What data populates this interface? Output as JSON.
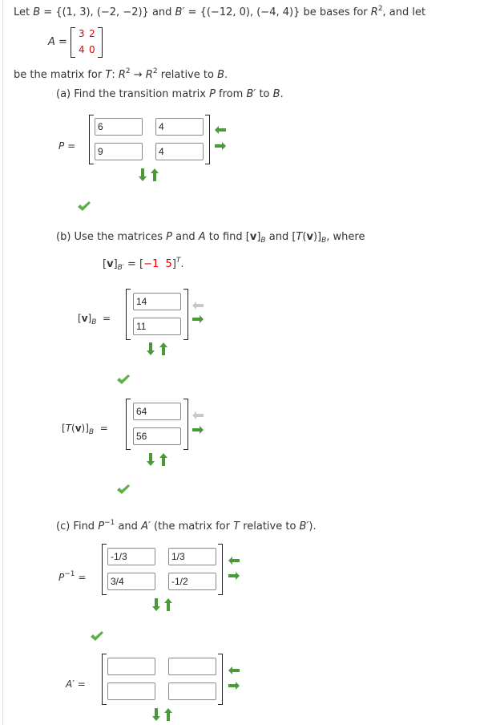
{
  "intro": {
    "line1_prefix": "Let ",
    "B_label": "B",
    "B_set": " = {(1, 3), (−2, −2)} and ",
    "Bp_label": "B′",
    "Bp_set": " = {(−12, 0), (−4, 4)} be bases for ",
    "R": "R",
    "R_exp": "2",
    "line1_suffix": ",  and let",
    "A_label": "A",
    "eq": "=",
    "A_matrix": [
      [
        "3",
        "2"
      ],
      [
        "4",
        "0"
      ]
    ],
    "line2_prefix": "be the matrix for ",
    "T": "T",
    "line2_mid": ": ",
    "arrow": " → ",
    "line2_suffix": " relative to "
  },
  "part_a": {
    "prompt_prefix": "(a) Find the transition matrix ",
    "P": "P",
    "prompt_mid": " from ",
    "Bp": "B′",
    "prompt_to": " to ",
    "B": "B",
    "period": ".",
    "label": "P =",
    "values": [
      [
        "6",
        "4"
      ],
      [
        "9",
        "4"
      ]
    ]
  },
  "part_b": {
    "prompt_prefix": "(b) Use the matrices ",
    "P": "P",
    "and": " and ",
    "A": "A",
    "to_find": " to find ",
    "v": "v",
    "B": "B",
    "Tv_T": "T",
    "where": ", where",
    "given_vec": [
      "−1",
      "5"
    ],
    "transpose": "T",
    "vB_values": [
      "14",
      "11"
    ],
    "TvB_values": [
      "64",
      "56"
    ]
  },
  "part_c": {
    "prompt_prefix": "(c) Find ",
    "P": "P",
    "inv": "−1",
    "and": " and ",
    "Ap": "A′",
    "paren": " (the matrix for ",
    "T": "T",
    "rel": " relative to ",
    "Bp": "B′",
    "close": ").",
    "Pinv_values": [
      [
        "-1/3",
        "1/3"
      ],
      [
        "3/4",
        "-1/2"
      ]
    ],
    "Ap_label": "A′ =",
    "Ap_values": [
      [
        "",
        ""
      ],
      [
        "",
        ""
      ]
    ]
  },
  "colors": {
    "accent_green": "#4a9a3a",
    "red": "#e00000",
    "gray_arrow": "#c8c8c8"
  }
}
